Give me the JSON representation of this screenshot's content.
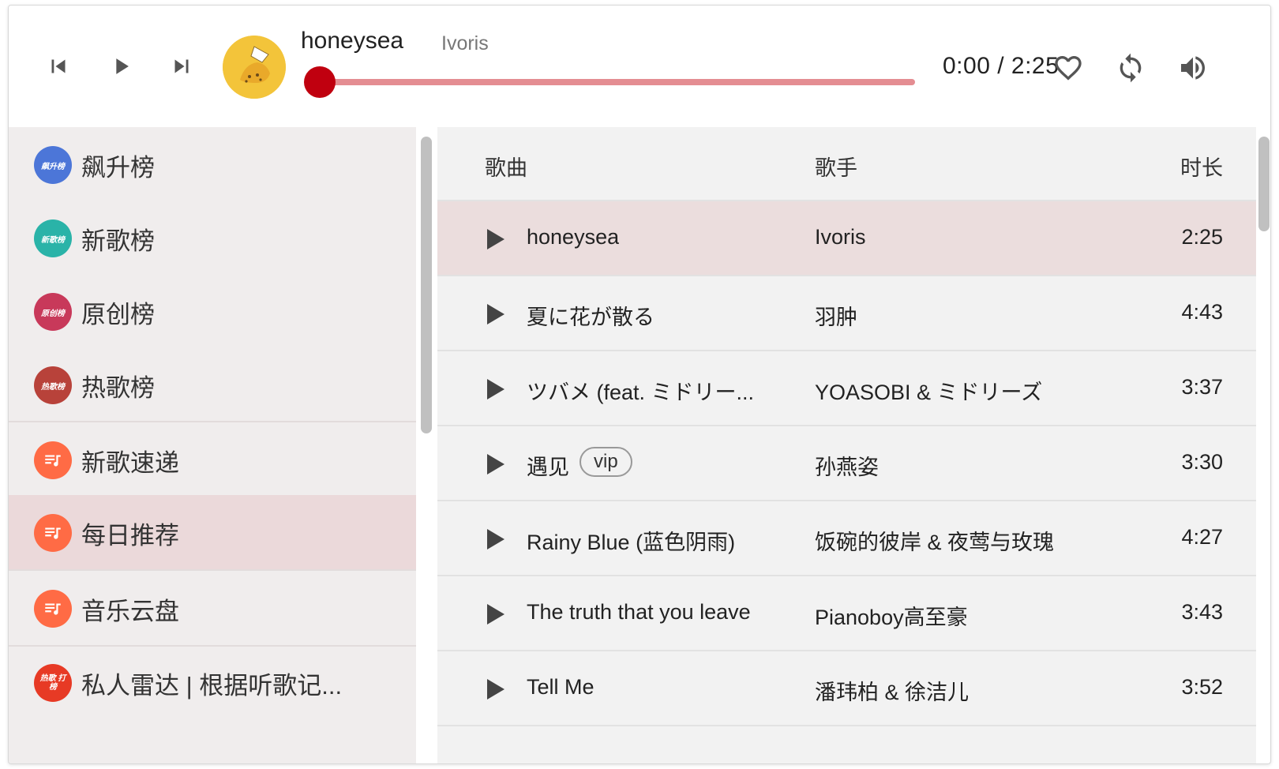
{
  "player": {
    "now_playing_title": "honeysea",
    "now_playing_artist": "Ivoris",
    "time_current": "0:00",
    "time_total": "2:25",
    "time_display": "0:00 / 2:25",
    "progress_fraction": 0.0,
    "accent_color": "#c0000f",
    "controls": [
      "previous-icon",
      "play-icon",
      "next-icon"
    ],
    "actions": [
      "heart-icon",
      "repeat-icon",
      "volume-icon"
    ]
  },
  "sidebar": {
    "items": [
      {
        "label": "飙升榜",
        "icon_text": "飙升榜",
        "color": "#4c76d8",
        "active": false
      },
      {
        "label": "新歌榜",
        "icon_text": "新歌榜",
        "color": "#2ab3a8",
        "active": false
      },
      {
        "label": "原创榜",
        "icon_text": "原创榜",
        "color": "#c8395a",
        "active": false
      },
      {
        "label": "热歌榜",
        "icon_text": "热歌榜",
        "color": "#b8423a",
        "active": false
      },
      {
        "label": "新歌速递",
        "icon_text": "",
        "color": "#ff6b45",
        "active": false
      },
      {
        "label": "每日推荐",
        "icon_text": "",
        "color": "#ff6b45",
        "active": true
      },
      {
        "label": "音乐云盘",
        "icon_text": "",
        "color": "#ff6b45",
        "active": false
      },
      {
        "label": "私人雷达 | 根据听歌记...",
        "icon_text": "热歌 打榜",
        "color": "#e73a25",
        "active": false
      }
    ]
  },
  "table": {
    "headers": {
      "song": "歌曲",
      "artist": "歌手",
      "duration": "时长"
    },
    "rows": [
      {
        "title": "honeysea",
        "artist": "Ivoris",
        "duration": "2:25",
        "vip": "",
        "active": true
      },
      {
        "title": "夏に花が散る",
        "artist": "羽肿",
        "duration": "4:43",
        "vip": "",
        "active": false
      },
      {
        "title": "ツバメ (feat. ミドリー...",
        "artist": "YOASOBI & ミドリーズ",
        "duration": "3:37",
        "vip": "",
        "active": false
      },
      {
        "title": "遇见",
        "artist": "孙燕姿",
        "duration": "3:30",
        "vip": "vip",
        "active": false
      },
      {
        "title": "Rainy Blue (蓝色阴雨)",
        "artist": "饭碗的彼岸 & 夜莺与玫瑰",
        "duration": "4:27",
        "vip": "",
        "active": false
      },
      {
        "title": "The truth that you leave",
        "artist": "Pianoboy高至豪",
        "duration": "3:43",
        "vip": "",
        "active": false
      },
      {
        "title": "Tell Me",
        "artist": "潘玮柏 & 徐洁儿",
        "duration": "3:52",
        "vip": "",
        "active": false
      }
    ]
  }
}
